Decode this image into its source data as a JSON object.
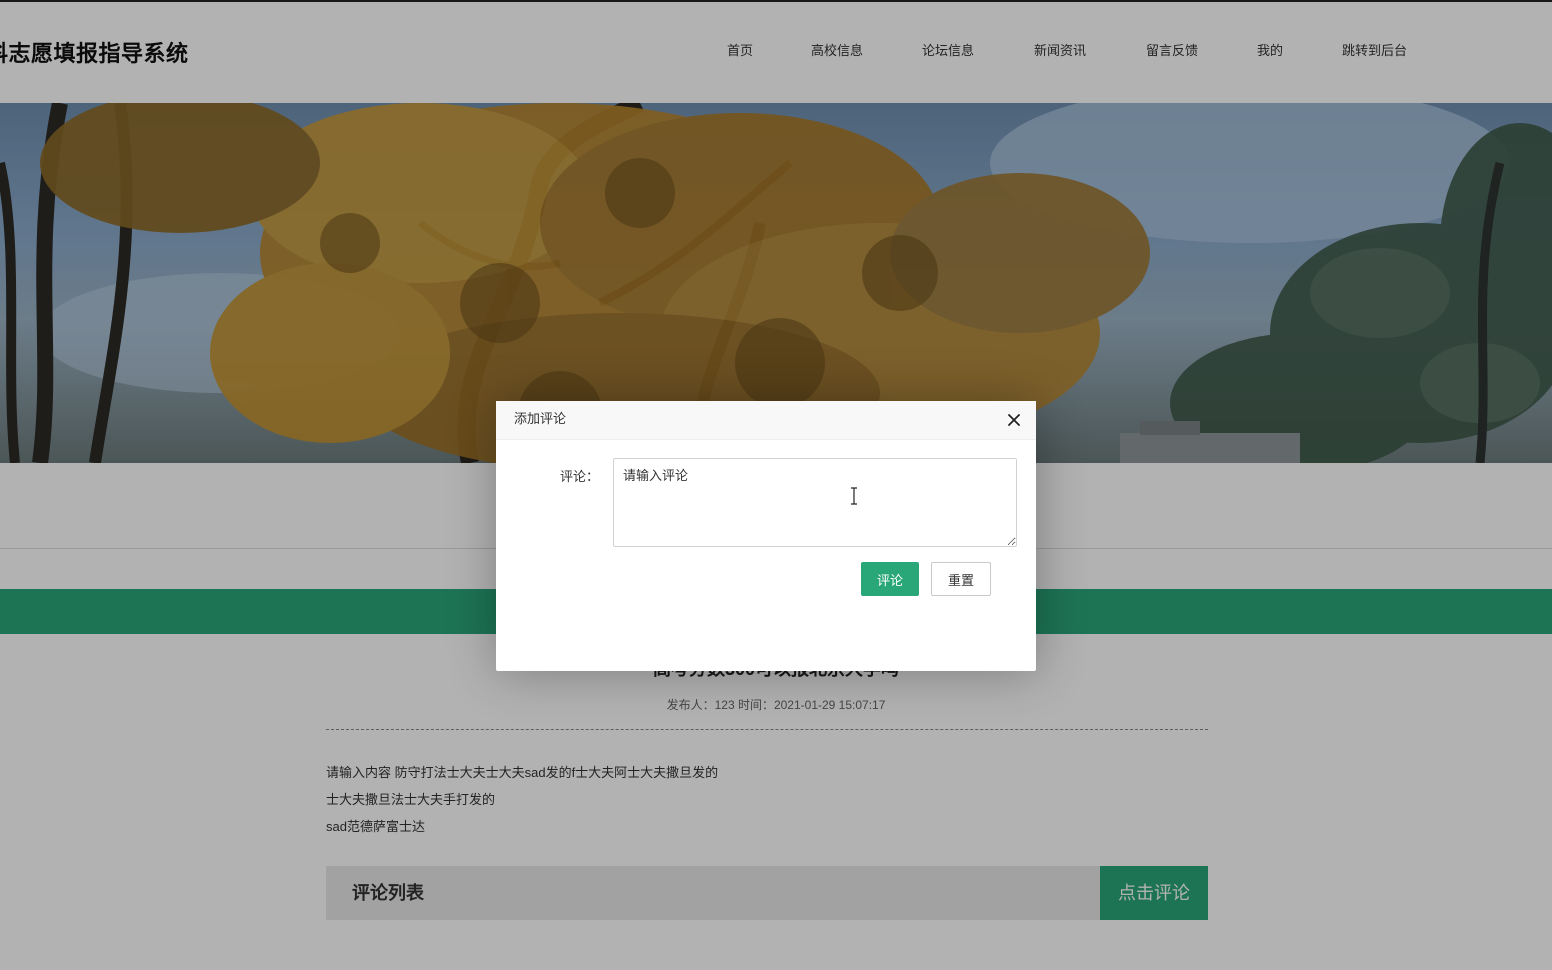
{
  "header": {
    "site_title": "科志愿填报指导系统",
    "nav": [
      "首页",
      "高校信息",
      "论坛信息",
      "新闻资讯",
      "留言反馈",
      "我的",
      "跳转到后台"
    ]
  },
  "article": {
    "title": "高考分数300可以报北京大学吗",
    "meta": "发布人：123 时间：2021-01-29 15:07:17",
    "body": [
      "请输入内容 防守打法士大夫士大夫sad发的f士大夫阿士大夫撒旦发的",
      "士大夫撒旦法士大夫手打发的",
      "sad范德萨富士达"
    ]
  },
  "comments": {
    "list_title": "评论列表",
    "add_button": "点击评论"
  },
  "dialog": {
    "title": "添加评论",
    "field_label": "评论：",
    "textarea_placeholder": "请输入评论",
    "textarea_value": "",
    "submit_label": "评论",
    "reset_label": "重置"
  },
  "colors": {
    "accent_green": "#2aa779",
    "shade": "rgba(0,0,0,0.3)"
  },
  "icons": {
    "close": "close-icon",
    "cursor": "text-cursor-icon"
  }
}
